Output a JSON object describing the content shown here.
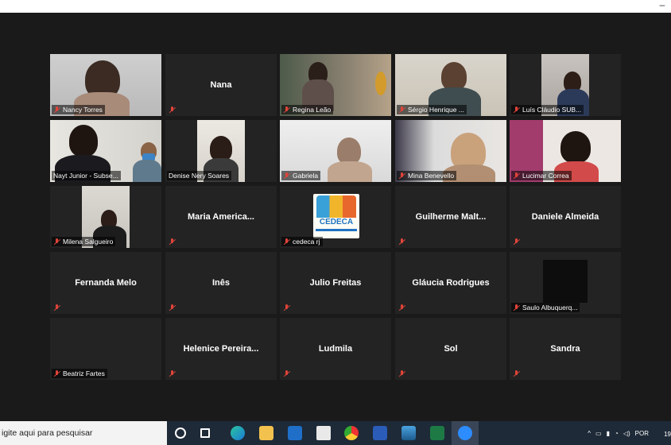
{
  "window": {
    "minimize_glyph": "–"
  },
  "participants": [
    {
      "name": "Nancy Torres",
      "label_type": "video"
    },
    {
      "name": "Nana",
      "label_type": "name_only"
    },
    {
      "name": "Regina Leão",
      "label_type": "video"
    },
    {
      "name": "Sérgio Henrique ...",
      "label_type": "video"
    },
    {
      "name": "Luís Cláudio SUB...",
      "label_type": "video"
    },
    {
      "name": "Nayt Junior - Subse...",
      "label_type": "video",
      "active_speaker": true
    },
    {
      "name": "Denise Nery Soares",
      "label_type": "video"
    },
    {
      "name": "Gabriela",
      "label_type": "video"
    },
    {
      "name": "Mina Benevello",
      "label_type": "video"
    },
    {
      "name": "Lucimar Correa",
      "label_type": "video"
    },
    {
      "name": "Milena Salgueiro",
      "label_type": "video"
    },
    {
      "name": "Maria  America...",
      "label_type": "name_only"
    },
    {
      "name": "cedeca rj",
      "label_type": "logo",
      "logo_text": "CEDECA"
    },
    {
      "name": "Guilherme  Malt...",
      "label_type": "name_only"
    },
    {
      "name": "Daniele Almeida",
      "label_type": "name_only"
    },
    {
      "name": "Fernanda Melo",
      "label_type": "name_only"
    },
    {
      "name": "Inês",
      "label_type": "name_only"
    },
    {
      "name": "Julio Freitas",
      "label_type": "name_only"
    },
    {
      "name": "Gláucia Rodrigues",
      "label_type": "name_only"
    },
    {
      "name": "Saulo Albuquerq...",
      "label_type": "video"
    },
    {
      "name": "Beatriz Fartes",
      "label_type": "bottom_only"
    },
    {
      "name": "Helenice  Pereira...",
      "label_type": "name_only"
    },
    {
      "name": "Ludmila",
      "label_type": "name_only"
    },
    {
      "name": "Sol",
      "label_type": "name_only"
    },
    {
      "name": "Sandra",
      "label_type": "name_only"
    }
  ],
  "taskbar": {
    "search_placeholder": "igite aqui para pesquisar",
    "language": "POR",
    "clock": "19"
  },
  "colors": {
    "muted_mic": "#e0443a",
    "active_border": "#e4e45a",
    "tile_bg": "#232323"
  }
}
